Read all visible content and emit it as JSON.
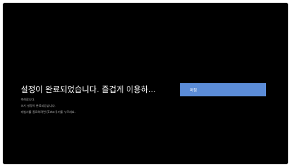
{
  "setup_complete": {
    "title": "설정이 완료되었습니다. 즐겁게 이용하...",
    "lines": [
      "축하합니다.",
      "초기 설정이 완료되었습니다.",
      "마법사를 종료하려면 [Enter] 키를 누르세요."
    ],
    "button_label": "마침"
  },
  "colors": {
    "background": "#000000",
    "button": "#5b8cd7",
    "title_text": "#ffffff",
    "body_text": "#b8b8b8"
  }
}
